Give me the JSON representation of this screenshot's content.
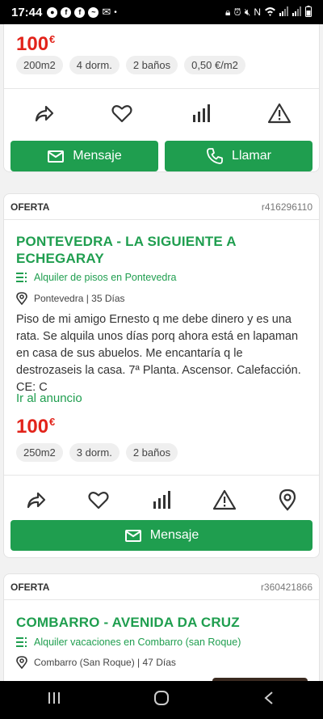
{
  "status_bar": {
    "time": "17:44",
    "left_icons": [
      "screen-record-icon",
      "facebook-icon",
      "facebook-icon",
      "messenger-icon",
      "gmail-icon",
      "dot-icon"
    ],
    "right_icons": [
      "lock-icon",
      "alarm-icon",
      "mute-icon",
      "nfc-icon",
      "wifi-icon",
      "signal-icon",
      "signal-icon",
      "battery-icon"
    ]
  },
  "colors": {
    "accent": "#1f9e4f",
    "price": "#e2231a"
  },
  "listing_top": {
    "price": "100",
    "currency": "€",
    "features": [
      "200m2",
      "4 dorm.",
      "2 baños",
      "0,50 €/m2"
    ],
    "actions": [
      "share-icon",
      "heart-icon",
      "stats-icon",
      "warning-icon"
    ],
    "message_label": "Mensaje",
    "call_label": "Llamar"
  },
  "listing_2": {
    "tag": "OFERTA",
    "ref": "r416296110",
    "title": "PONTEVEDRA - LA SIGUIENTE A ECHEGARAY",
    "category": "Alquiler de pisos en Pontevedra",
    "location": "Pontevedra | 35 Días",
    "description": "Piso de mi amigo Ernesto q me debe dinero y es una rata. Se alquila unos días porq ahora está en lapaman en casa de sus abuelos. Me encantaría q le destrozaseis la casa. 7ª Planta. Ascensor. Calefacción. CE: C",
    "link": "Ir al anuncio",
    "price": "100",
    "currency": "€",
    "features": [
      "250m2",
      "3 dorm.",
      "2 baños"
    ],
    "actions": [
      "share-icon",
      "heart-icon",
      "stats-icon",
      "warning-icon",
      "location-icon"
    ],
    "message_label": "Mensaje"
  },
  "listing_3": {
    "tag": "OFERTA",
    "ref": "r360421866",
    "title": "COMBARRO - AVENIDA DA CRUZ",
    "category": "Alquiler vacaciones en Combarro (san Roque)",
    "location": "Combarro (San Roque) | 47 Días"
  },
  "nav_bar": [
    "recent-apps-icon",
    "home-icon",
    "back-icon"
  ]
}
